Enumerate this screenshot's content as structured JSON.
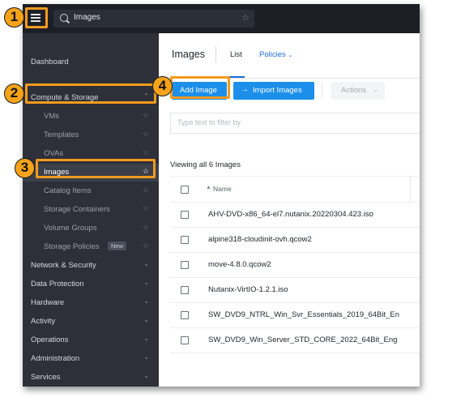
{
  "search": {
    "value": "Images"
  },
  "sidebar": {
    "dashboard": "Dashboard",
    "compute_storage": "Compute & Storage",
    "items": [
      {
        "label": "VMs"
      },
      {
        "label": "Templates"
      },
      {
        "label": "OVAs"
      },
      {
        "label": "Images"
      },
      {
        "label": "Catalog Items"
      },
      {
        "label": "Storage Containers"
      },
      {
        "label": "Volume Groups"
      },
      {
        "label": "Storage Policies",
        "badge": "New"
      }
    ],
    "sections": [
      {
        "label": "Network & Security"
      },
      {
        "label": "Data Protection"
      },
      {
        "label": "Hardware"
      },
      {
        "label": "Activity"
      },
      {
        "label": "Operations"
      },
      {
        "label": "Administration"
      },
      {
        "label": "Services"
      }
    ]
  },
  "header": {
    "title": "Images",
    "tab_list": "List",
    "tab_policies": "Policies"
  },
  "toolbar": {
    "add_image": "Add Image",
    "import_images": "Import Images",
    "actions": "Actions"
  },
  "filter": {
    "placeholder": "Type text to filter by"
  },
  "table": {
    "summary": "Viewing all 6 Images",
    "column_name": "Name",
    "rows": [
      "AHV-DVD-x86_64-el7.nutanix.20220304.423.iso",
      "alpine318-cloudinit-ovh.qcow2",
      "move-4.8.0.qcow2",
      "Nutanix-VirtIO-1.2.1.iso",
      "SW_DVD9_NTRL_Win_Svr_Essentials_2019_64Bit_En",
      "SW_DVD9_Win_Server_STD_CORE_2022_64Bit_Eng"
    ]
  },
  "callouts": [
    "1",
    "2",
    "3",
    "4"
  ],
  "colors": {
    "accent": "#1b8fea",
    "callout": "#f39a1e",
    "sidebar": "#2d3039",
    "topbar": "#1c1f26"
  }
}
